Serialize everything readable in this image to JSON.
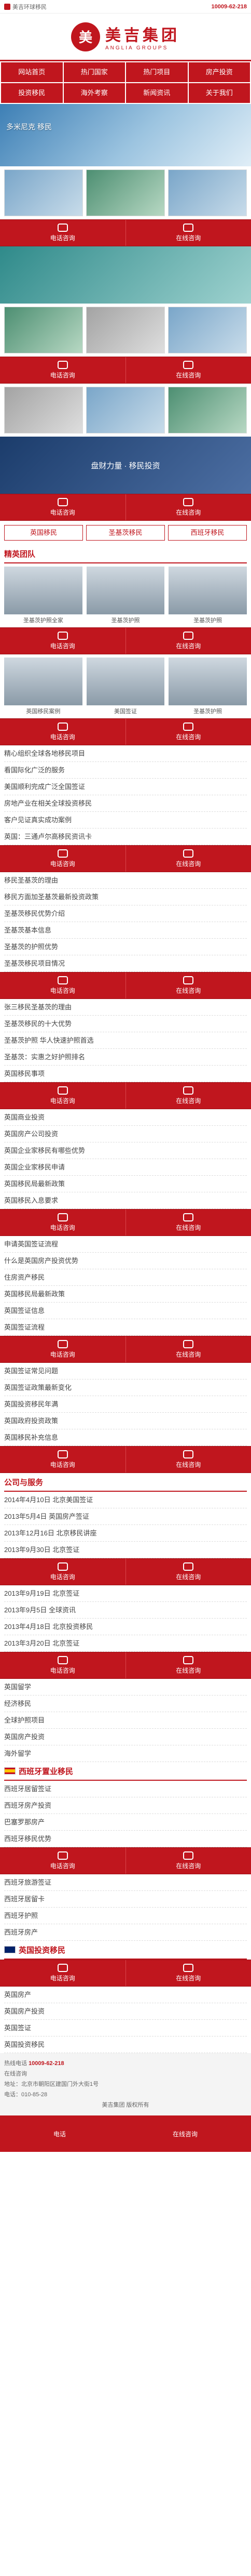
{
  "topbar": {
    "left": "美吉环球移民",
    "hotline": "10009-62-218"
  },
  "logo": {
    "mark": "美",
    "name": "美吉集团",
    "sub": "ANGLIA GROUPS"
  },
  "nav": [
    "网站首页",
    "热门国家",
    "热门项目",
    "房产投资",
    "投资移民",
    "海外考察",
    "新闻资讯",
    "关于我们"
  ],
  "cta": {
    "call": "电话咨询",
    "online": "在线咨询"
  },
  "banner": {
    "cap": "多米尼克 移民"
  },
  "banner3": {
    "cap": "盘财力量 · 移民投资"
  },
  "tabs": [
    "英国移民",
    "圣基茨移民",
    "西班牙移民"
  ],
  "team_title": "精英团队",
  "team": [
    {
      "name": "圣基茨护照全家"
    },
    {
      "name": "圣基茨护照"
    },
    {
      "name": "圣基茨护照"
    },
    {
      "name": "英国移民案例"
    },
    {
      "name": "美国签证"
    },
    {
      "name": "圣基茨护照"
    },
    {
      "name": "圣基茨护照"
    },
    {
      "name": ""
    },
    {
      "name": ""
    }
  ],
  "list1": [
    "精心组织全球各地移民项目",
    "看国际化广泛的服务",
    "美国顺利完成广泛全国签证",
    "房地产业在相关全球投资移民",
    "客户见证真实成功案例",
    "英国：三通卢尔高移民资讯卡"
  ],
  "list2": [
    "移民圣基茨的理由",
    "移民方面加圣基茨最新投资政策",
    "圣基茨移民优势介绍",
    "圣基茨基本信息",
    "圣基茨的护照优势",
    "圣基茨移民项目情况"
  ],
  "list3": [
    "张三移民圣基茨的理由",
    "圣基茨移民的十大优势",
    "圣基茨护照 华人快速护照首选",
    "圣基茨：实惠之好护照排名",
    "英国移民事项"
  ],
  "list4": [
    "英国商业投资",
    "英国房产公司投资",
    "英国企业家移民有哪些优势",
    "英国企业家移民申请",
    "英国移民局最新政策",
    "英国移民入息要求"
  ],
  "list5": [
    "申请英国签证流程",
    "什么是英国房产投资优势",
    "住房资产移民",
    "英国移民局最新政策",
    "英国签证信息",
    "英国签证流程"
  ],
  "list6": [
    "英国签证常见问题",
    "英国签证政策最新变化",
    "英国投资移民年满",
    "英国政府投资政策",
    "英国移民补充信息"
  ],
  "news_title": "公司与服务",
  "list7": [
    "2014年4月10日 北京美国签证",
    "2013年5月4日 英国房产签证",
    "2013年12月16日 北京移民讲座",
    "2013年9月30日 北京签证"
  ],
  "list8": [
    "2013年9月19日 北京签证",
    "2013年9月5日 全球资讯",
    "2013年4月18日 北京投资移民",
    "2013年3月20日 北京签证"
  ],
  "list9": [
    "英国留学",
    "经济移民",
    "全球护照项目",
    "英国房产投资",
    "海外留学"
  ],
  "spain_title": "西班牙置业移民",
  "list10": [
    "西班牙居留签证",
    "西班牙房产投资",
    "巴塞罗那房产",
    "西班牙移民优势"
  ],
  "list11": [
    "西班牙旅游签证",
    "西班牙居留卡",
    "西班牙护照",
    "西班牙房产"
  ],
  "uk_title": "英国投资移民",
  "list12": [
    "英国房产",
    "英国房产投资",
    "英国签证",
    "英国投资移民"
  ],
  "footer": {
    "hotline_label": "热线电话",
    "hotline": "10009-62-218",
    "online": "在线咨询",
    "address": "地址：北京市朝阳区建国门外大街1号",
    "phone": "电话：010-85-28",
    "copyright": "美吉集团 版权所有"
  },
  "bottom": {
    "home": "电话",
    "online": "在线咨询"
  }
}
